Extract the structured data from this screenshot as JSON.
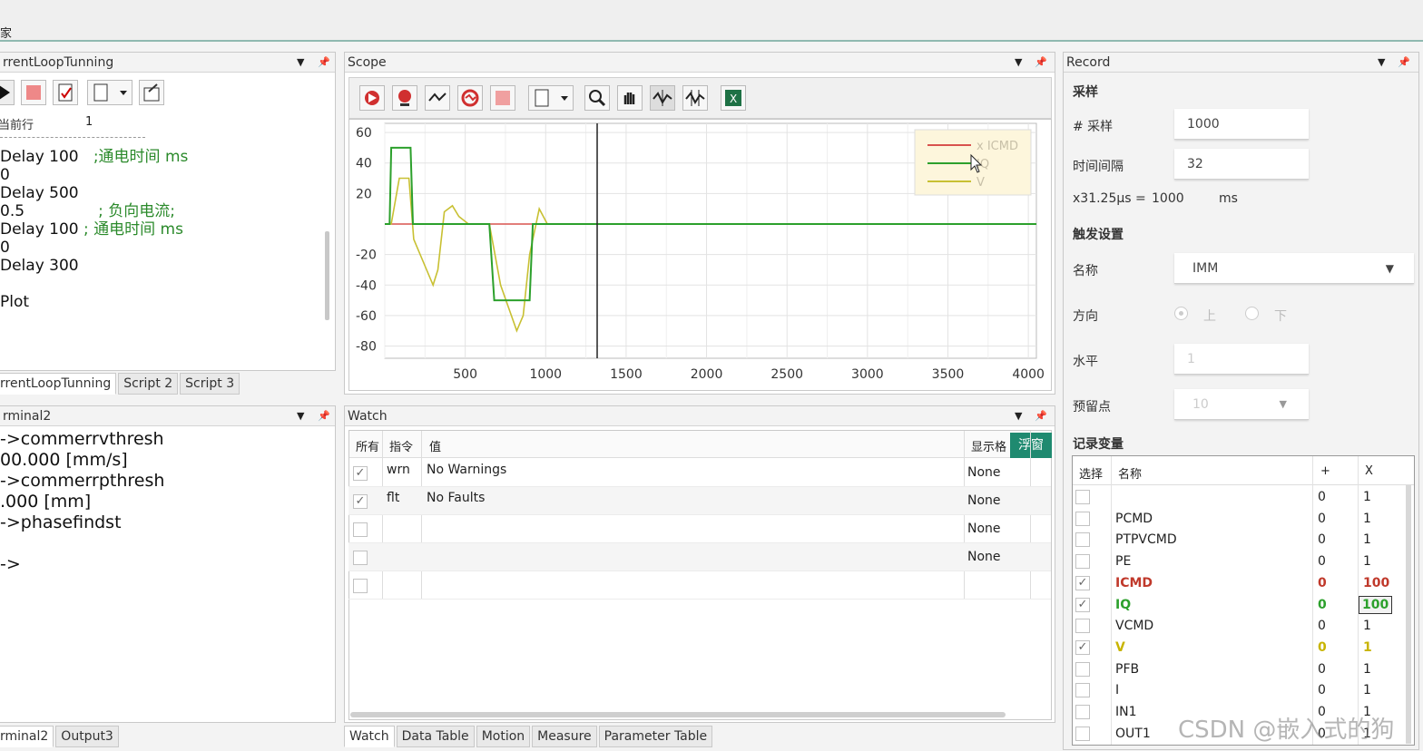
{
  "top": {
    "left_fragment": "家"
  },
  "colors": {
    "icmd": "#d9534f",
    "iq": "#2ca02c",
    "v": "#c8c032",
    "accent": "#1f8a70"
  },
  "script_panel": {
    "title": "rrentLoopTunning",
    "line_label": "当前行",
    "line_value": "1",
    "code": [
      {
        "t": "Delay 100",
        "c": ";通电时间 ms"
      },
      {
        "t": "0",
        "c": ""
      },
      {
        "t": "Delay 500",
        "c": ""
      },
      {
        "t": "0.5",
        "c": "; 负向电流;"
      },
      {
        "t": "Delay 100",
        "c": "; 通电时间 ms"
      },
      {
        "t": "0",
        "c": ""
      },
      {
        "t": "Delay 300",
        "c": ""
      },
      {
        "t": "",
        "c": ""
      },
      {
        "t": "Plot",
        "c": ""
      }
    ],
    "tabs": [
      "rrentLoopTunning",
      "Script 2",
      "Script 3"
    ]
  },
  "terminal_panel": {
    "title": "rminal2",
    "lines": [
      "->commerrvthresh",
      "00.000 [mm/s]",
      "->commerrpthresh",
      ".000 [mm]",
      "->phasefindst",
      "",
      "->"
    ],
    "tabs": [
      "rminal2",
      "Output3"
    ]
  },
  "scope": {
    "title": "Scope",
    "toolbar_icons": [
      "record-red-icon",
      "record-single-icon",
      "signal-icon",
      "cycle-icon",
      "stop-icon",
      "document-icon",
      "zoom-icon",
      "pan-hand-icon",
      "waveform-icon",
      "waveform-cursor-icon",
      "excel-icon"
    ]
  },
  "chart_data": {
    "type": "line",
    "xlim": [
      0,
      4050
    ],
    "ylim": [
      -88,
      66
    ],
    "xticks": [
      500,
      1000,
      1500,
      2000,
      2500,
      3000,
      3500,
      4000
    ],
    "yticks": [
      60,
      40,
      20,
      -20,
      -40,
      -60,
      -80
    ],
    "cursor_x": 1320,
    "grid": true,
    "legend_position": "top-right",
    "series": [
      {
        "name": "x ICMD",
        "points": [
          [
            0,
            0
          ],
          [
            4050,
            0
          ]
        ]
      },
      {
        "name": "IQ",
        "points": [
          [
            0,
            0
          ],
          [
            30,
            0
          ],
          [
            40,
            50
          ],
          [
            160,
            50
          ],
          [
            175,
            0
          ],
          [
            650,
            0
          ],
          [
            680,
            -50
          ],
          [
            900,
            -50
          ],
          [
            920,
            0
          ],
          [
            1200,
            0
          ],
          [
            4050,
            0
          ]
        ]
      },
      {
        "name": "V",
        "points": [
          [
            0,
            0
          ],
          [
            40,
            0
          ],
          [
            90,
            30
          ],
          [
            150,
            30
          ],
          [
            180,
            -10
          ],
          [
            260,
            -30
          ],
          [
            300,
            -40
          ],
          [
            330,
            -30
          ],
          [
            370,
            8
          ],
          [
            420,
            12
          ],
          [
            460,
            5
          ],
          [
            520,
            0
          ],
          [
            650,
            0
          ],
          [
            720,
            -40
          ],
          [
            770,
            -55
          ],
          [
            820,
            -70
          ],
          [
            860,
            -60
          ],
          [
            900,
            -20
          ],
          [
            960,
            10
          ],
          [
            1010,
            0
          ],
          [
            1200,
            0
          ],
          [
            4050,
            0
          ]
        ]
      }
    ]
  },
  "watch": {
    "title": "Watch",
    "headers": [
      "所有",
      "指令",
      "值",
      "显示格"
    ],
    "float_button": "浮窗",
    "rows": [
      {
        "checked": "✓",
        "cmd": "wrn",
        "value": "No Warnings",
        "fmt": "None"
      },
      {
        "checked": "✓",
        "cmd": "flt",
        "value": "No Faults",
        "fmt": "None"
      },
      {
        "checked": "",
        "cmd": "",
        "value": "",
        "fmt": "None"
      },
      {
        "checked": "",
        "cmd": "",
        "value": "",
        "fmt": "None"
      },
      {
        "checked": "",
        "cmd": "",
        "value": "",
        "fmt": ""
      }
    ],
    "tabs": [
      "Watch",
      "Data Table",
      "Motion",
      "Measure",
      "Parameter Table"
    ]
  },
  "record": {
    "title": "Record",
    "sampling_heading": "采样",
    "samples_label": "# 采样",
    "samples_value": "1000",
    "interval_label": "时间间隔",
    "interval_value": "32",
    "calc_label": "x31.25μs =",
    "calc_value": "1000",
    "calc_unit": "ms",
    "trigger_heading": "触发设置",
    "name_label": "名称",
    "name_value": "IMM",
    "direction_label": "方向",
    "dir_up": "上",
    "dir_down": "下",
    "level_label": "水平",
    "level_value": "1",
    "pretrigger_label": "预留点",
    "pretrigger_value": "10",
    "vars_heading": "记录变量",
    "var_headers": [
      "选择",
      "名称",
      "+",
      "X"
    ],
    "vars": [
      {
        "sel": "",
        "name": "",
        "plus": "0",
        "x": "1",
        "cls": ""
      },
      {
        "sel": "",
        "name": "PCMD",
        "plus": "0",
        "x": "1",
        "cls": ""
      },
      {
        "sel": "",
        "name": "PTPVCMD",
        "plus": "0",
        "x": "1",
        "cls": ""
      },
      {
        "sel": "",
        "name": "PE",
        "plus": "0",
        "x": "1",
        "cls": ""
      },
      {
        "sel": "✓",
        "name": "ICMD",
        "plus": "0",
        "x": "100",
        "cls": "red"
      },
      {
        "sel": "✓",
        "name": "IQ",
        "plus": "0",
        "x": "100",
        "cls": "green"
      },
      {
        "sel": "",
        "name": "VCMD",
        "plus": "0",
        "x": "1",
        "cls": ""
      },
      {
        "sel": "✓",
        "name": "V",
        "plus": "0",
        "x": "1",
        "cls": "olive"
      },
      {
        "sel": "",
        "name": "PFB",
        "plus": "0",
        "x": "1",
        "cls": ""
      },
      {
        "sel": "",
        "name": "I",
        "plus": "0",
        "x": "1",
        "cls": ""
      },
      {
        "sel": "",
        "name": "IN1",
        "plus": "0",
        "x": "1",
        "cls": ""
      },
      {
        "sel": "",
        "name": "OUT1",
        "plus": "0",
        "x": "1",
        "cls": ""
      }
    ]
  },
  "watermark": "CSDN @嵌入式的狗"
}
